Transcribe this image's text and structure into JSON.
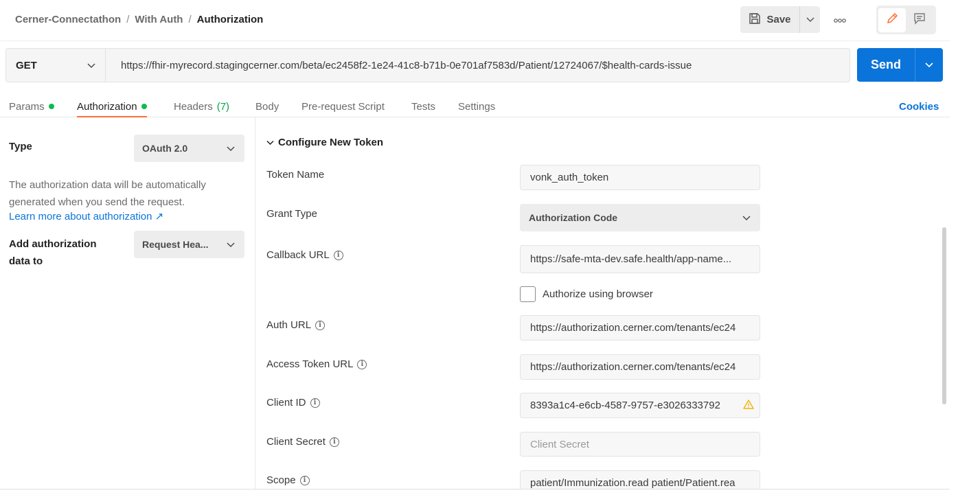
{
  "breadcrumb": {
    "items": [
      "Cerner-Connectathon",
      "With Auth"
    ],
    "separator": "/",
    "current": "Authorization"
  },
  "toolbar": {
    "save_label": "Save"
  },
  "request": {
    "method": "GET",
    "url": "https://fhir-myrecord.stagingcerner.com/beta/ec2458f2-1e24-41c8-b71b-0e701af7583d/Patient/12724067/$health-cards-issue",
    "send_label": "Send"
  },
  "tabs": {
    "items": [
      {
        "label": "Params",
        "dot": true
      },
      {
        "label": "Authorization",
        "dot": true,
        "active": true
      },
      {
        "label": "Headers",
        "count": "(7)"
      },
      {
        "label": "Body"
      },
      {
        "label": "Pre-request Script"
      },
      {
        "label": "Tests"
      },
      {
        "label": "Settings"
      }
    ],
    "cookies_label": "Cookies"
  },
  "left_panel": {
    "type_label": "Type",
    "type_value": "OAuth 2.0",
    "help_text": "The authorization data will be automatically generated when you send the request.",
    "learn_link": "Learn more about authorization ↗",
    "add_label": "Add authorization data to",
    "add_value": "Request Hea..."
  },
  "config": {
    "section_title": "Configure New Token",
    "token_name_label": "Token Name",
    "token_name_value": "vonk_auth_token",
    "grant_type_label": "Grant Type",
    "grant_type_value": "Authorization Code",
    "callback_url_label": "Callback URL",
    "callback_url_value": "https://safe-mta-dev.safe.health/app-name...",
    "authorize_browser_label": "Authorize using browser",
    "auth_url_label": "Auth URL",
    "auth_url_value": "https://authorization.cerner.com/tenants/ec24",
    "access_token_url_label": "Access Token URL",
    "access_token_url_value": "https://authorization.cerner.com/tenants/ec24",
    "client_id_label": "Client ID",
    "client_id_value": "8393a1c4-e6cb-4587-9757-e3026333792",
    "client_secret_label": "Client Secret",
    "client_secret_placeholder": "Client Secret",
    "scope_label": "Scope",
    "scope_value": "patient/Immunization.read patient/Patient.rea"
  },
  "colors": {
    "accent": "#0a74da",
    "active_tab_underline": "#ff6c37",
    "status_dot": "#0cbb52",
    "warning": "#f0b400"
  }
}
